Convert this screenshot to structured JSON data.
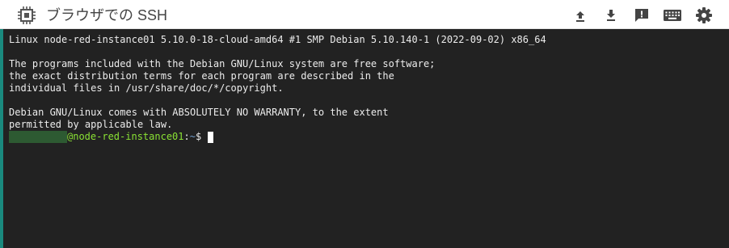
{
  "app": {
    "title": "ブラウザでの SSH",
    "logo_icon": "chip-icon"
  },
  "toolbar": {
    "buttons": [
      {
        "name": "upload-file-button",
        "icon": "upload-icon"
      },
      {
        "name": "download-file-button",
        "icon": "download-icon"
      },
      {
        "name": "send-feedback-button",
        "icon": "feedback-icon"
      },
      {
        "name": "keyboard-button",
        "icon": "keyboard-icon"
      },
      {
        "name": "settings-button",
        "icon": "gear-icon"
      }
    ]
  },
  "terminal": {
    "lines": [
      "Linux node-red-instance01 5.10.0-18-cloud-amd64 #1 SMP Debian 5.10.140-1 (2022-09-02) x86_64",
      "",
      "The programs included with the Debian GNU/Linux system are free software;",
      "the exact distribution terms for each program are described in the",
      "individual files in /usr/share/doc/*/copyright.",
      "",
      "Debian GNU/Linux comes with ABSOLUTELY NO WARRANTY, to the extent",
      "permitted by applicable law."
    ],
    "prompt": {
      "host": "@node-red-instance01",
      "separator": ":",
      "path": "~",
      "symbol": "$"
    }
  },
  "colors": {
    "terminal_bg": "#222222",
    "terminal_fg": "#ececec",
    "prompt_host": "#8ae234",
    "prompt_path": "#729fcf",
    "accent_edge": "#1a8a7e"
  }
}
